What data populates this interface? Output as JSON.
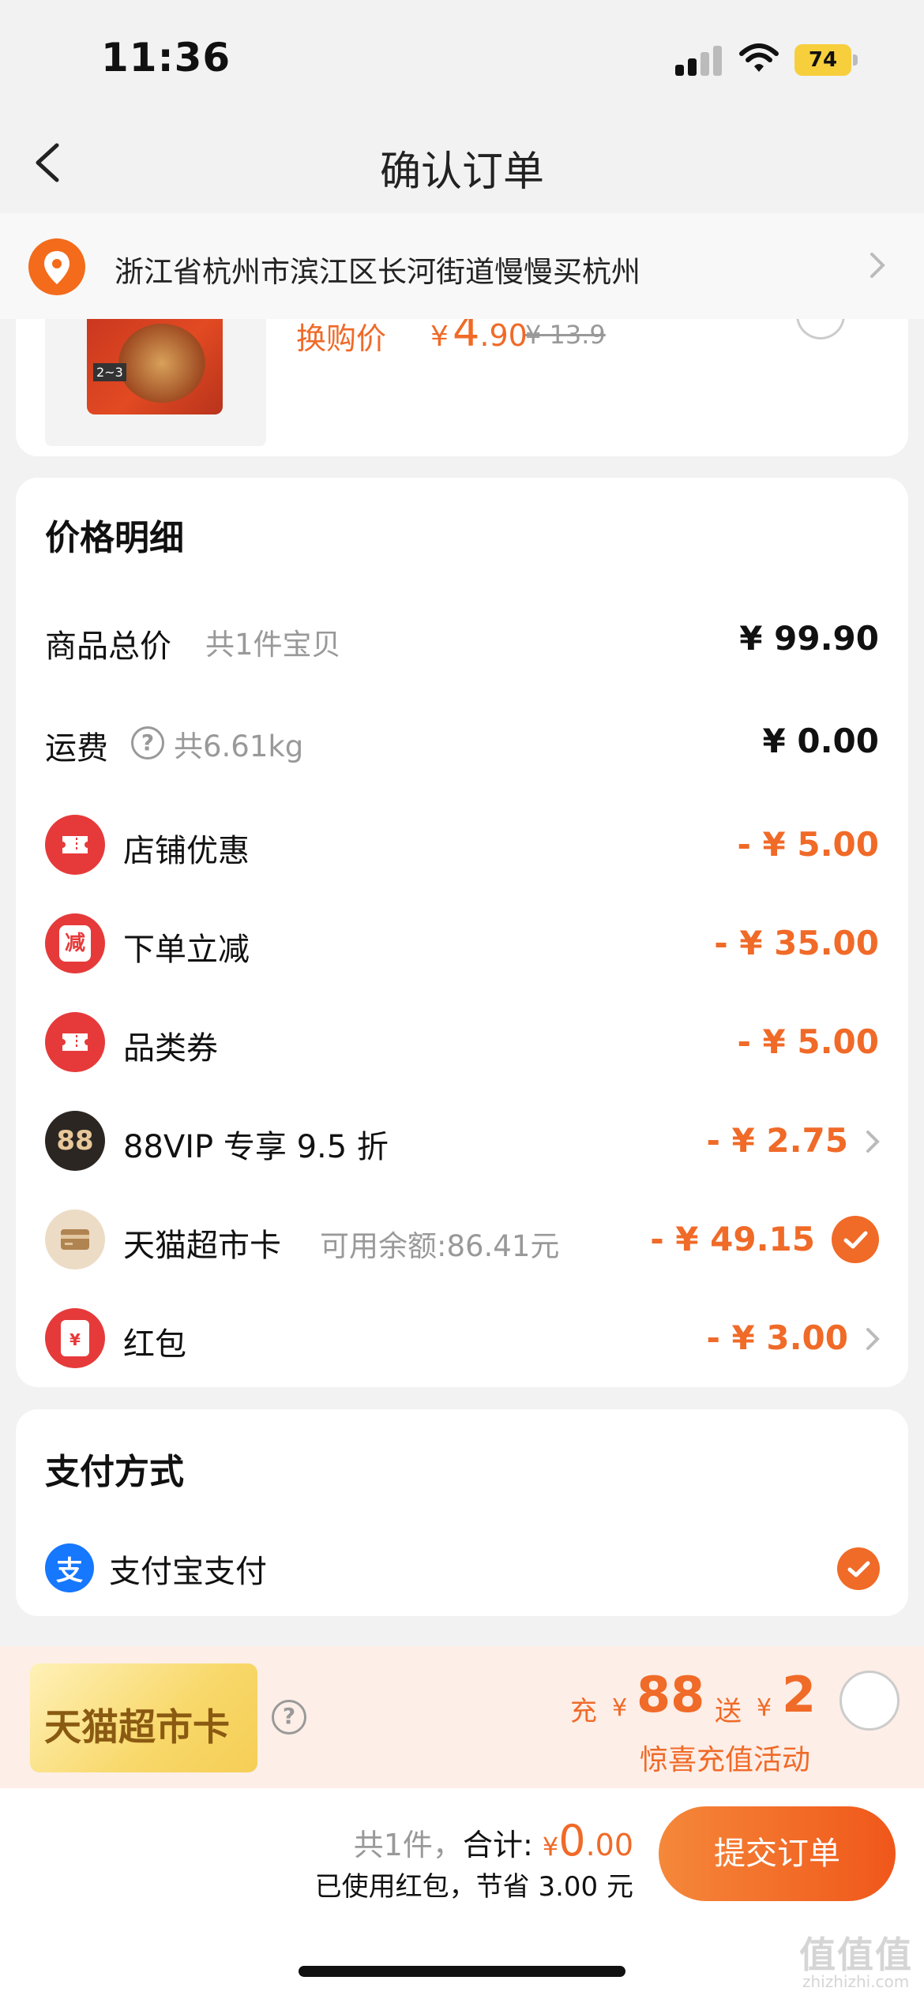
{
  "status_bar": {
    "time": "11:36",
    "battery": "74"
  },
  "nav": {
    "title": "确认订单"
  },
  "address": {
    "text": "浙江省杭州市滨江区长河街道慢慢买杭州"
  },
  "product": {
    "swap_label": "换购价",
    "currency": "¥",
    "price_int": "4",
    "price_dec": ".90",
    "original_price": "¥ 13.9",
    "thumb_tag": "2~3"
  },
  "price_detail": {
    "title": "价格明细",
    "goods_total_label": "商品总价",
    "goods_total_sub": "共1件宝贝",
    "goods_total_value": "¥ 99.90",
    "shipping_label": "运费",
    "shipping_help": "?",
    "shipping_sub": "共6.61kg",
    "shipping_value": "¥ 0.00",
    "rows": [
      {
        "label": "店铺优惠",
        "value": "- ¥ 5.00",
        "icon": "ticket-icon"
      },
      {
        "label": "下单立减",
        "value": "- ¥ 35.00",
        "icon": "reduce-icon",
        "icon_text": "减"
      },
      {
        "label": "品类券",
        "value": "- ¥ 5.00",
        "icon": "ticket-icon"
      },
      {
        "label": "88VIP 专享 9.5 折",
        "value": "- ¥ 2.75",
        "icon": "88vip-icon",
        "icon_text": "88"
      },
      {
        "label": "天猫超市卡",
        "sub": "可用余额:86.41元",
        "value": "- ¥ 49.15",
        "icon": "card-icon"
      },
      {
        "label": "红包",
        "value": "- ¥ 3.00",
        "icon": "red-packet-icon",
        "icon_text": "¥"
      }
    ]
  },
  "payment": {
    "title": "支付方式",
    "method_label": "支付宝支付",
    "method_icon_text": "支"
  },
  "promo": {
    "card_label": "天猫超市卡",
    "help": "?",
    "charge_prefix": "充",
    "charge_currency": "¥",
    "charge_amount": "88",
    "gift_prefix": "送",
    "gift_currency": "¥",
    "gift_amount": "2",
    "sub": "惊喜充值活动"
  },
  "bottom": {
    "count": "共1件，",
    "total_label": "合计:",
    "total_currency": "¥",
    "total_int": "0",
    "total_dec": ".00",
    "saved": "已使用红包，节省 3.00 元",
    "submit": "提交订单"
  },
  "watermark": {
    "main": "值值值",
    "sub": "zhizhizhi.com"
  },
  "colors": {
    "accent": "#f06a28",
    "icon_red": "#e63a3a"
  }
}
